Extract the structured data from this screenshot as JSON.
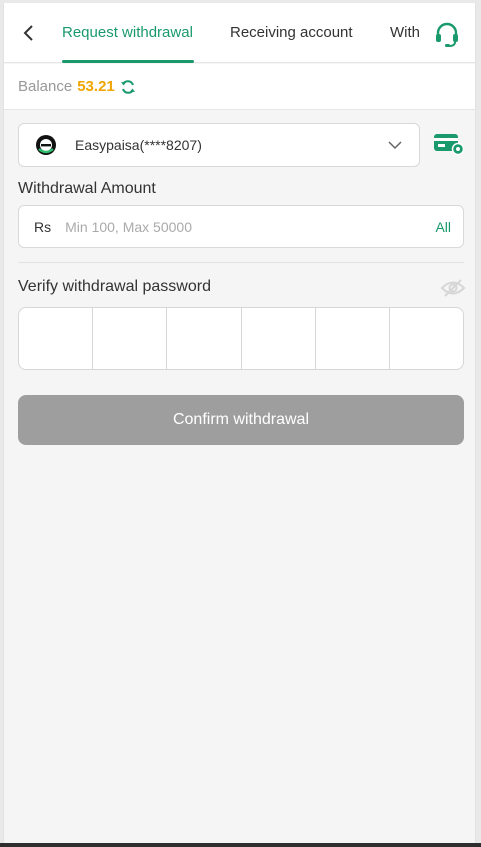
{
  "header": {
    "tabs": [
      {
        "label": "Request withdrawal",
        "active": true
      },
      {
        "label": "Receiving account",
        "active": false
      },
      {
        "label": "With",
        "active": false
      }
    ],
    "back_icon": "chevron-left-icon",
    "support_icon": "headset-icon"
  },
  "balance": {
    "label": "Balance",
    "value": "53.21",
    "refresh_icon": "refresh-icon"
  },
  "account": {
    "selected": "Easypaisa(****8207)",
    "logo_icon": "easypaisa-logo",
    "card_settings_icon": "card-settings-icon"
  },
  "amount": {
    "label": "Withdrawal Amount",
    "currency": "Rs",
    "placeholder": "Min 100, Max 50000",
    "all_label": "All"
  },
  "password": {
    "label": "Verify withdrawal password",
    "visibility_icon": "eye-off-icon"
  },
  "confirm_label": "Confirm withdrawal",
  "colors": {
    "accent": "#1a9a6c",
    "balance": "#f0a500",
    "button_disabled": "#9e9e9e"
  }
}
